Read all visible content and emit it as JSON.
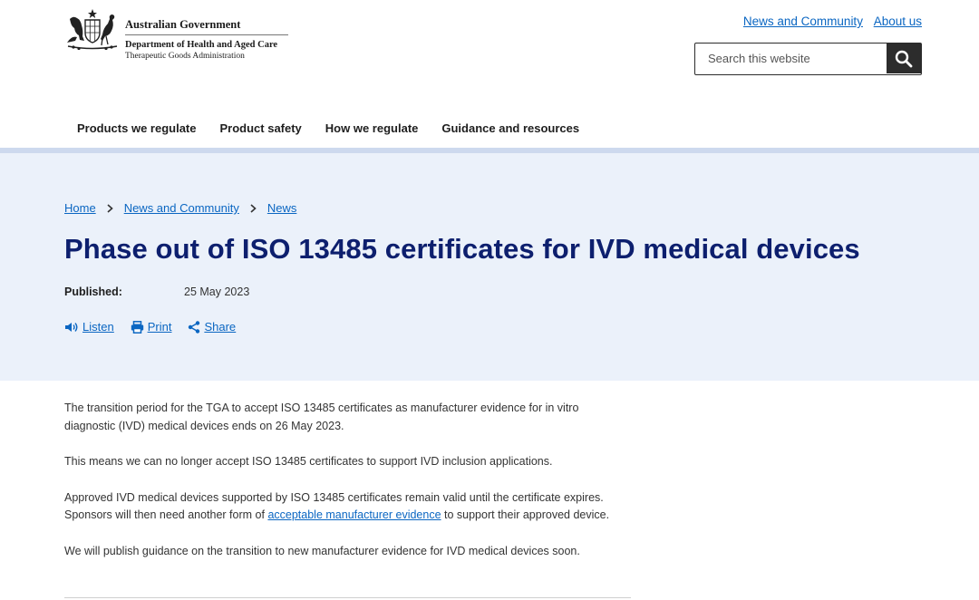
{
  "header": {
    "gov_name": "Australian Government",
    "department": "Department of Health and Aged Care",
    "agency": "Therapeutic Goods Administration",
    "util_links": [
      "News and Community",
      "About us"
    ],
    "search_placeholder": "Search this website"
  },
  "nav": {
    "items": [
      "Products we regulate",
      "Product safety",
      "How we regulate",
      "Guidance and resources"
    ]
  },
  "breadcrumb": [
    "Home",
    "News and Community",
    "News"
  ],
  "page": {
    "title": "Phase out of ISO 13485 certificates for IVD medical devices",
    "published_label": "Published:",
    "published_date": "25 May 2023",
    "actions": [
      "Listen",
      "Print",
      "Share"
    ]
  },
  "content": {
    "p1": "The transition period for the TGA to accept ISO 13485 certificates as manufacturer evidence for in vitro diagnostic (IVD) medical devices ends on 26 May 2023.",
    "p2": "This means we can no longer accept ISO 13485 certificates to support IVD inclusion applications.",
    "p3_before": "Approved IVD medical devices supported by ISO 13485 certificates remain valid until the certificate expires. Sponsors will then need another form of ",
    "p3_link": "acceptable manufacturer evidence",
    "p3_after": " to support their approved device.",
    "p4": "We will publish guidance on the transition to new manufacturer evidence for IVD medical devices soon."
  },
  "colors": {
    "title": "#0d1f6e",
    "link": "#0a66c2",
    "hero_bg": "#ebf1fa",
    "nav_rule": "#cdd9ee",
    "search_button": "#2c2c2c"
  }
}
